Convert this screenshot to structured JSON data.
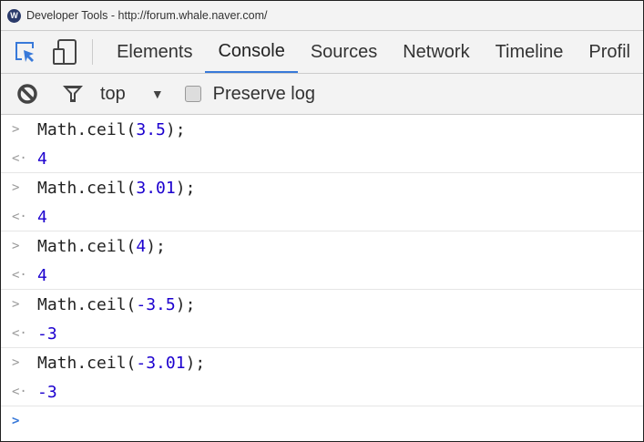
{
  "window": {
    "title": "Developer Tools - http://forum.whale.naver.com/"
  },
  "tabs": [
    {
      "label": "Elements"
    },
    {
      "label": "Console",
      "active": true
    },
    {
      "label": "Sources"
    },
    {
      "label": "Network"
    },
    {
      "label": "Timeline"
    },
    {
      "label": "Profil"
    }
  ],
  "toolbar": {
    "context": "top",
    "preserve_log_label": "Preserve log",
    "preserve_log_checked": false
  },
  "entries": [
    {
      "prefix": "Math.ceil(",
      "arg": "3.5",
      "suffix": ");",
      "result": "4"
    },
    {
      "prefix": "Math.ceil(",
      "arg": "3.01",
      "suffix": ");",
      "result": "4"
    },
    {
      "prefix": "Math.ceil(",
      "arg": "4",
      "suffix": ");",
      "result": "4"
    },
    {
      "prefix": "Math.ceil(",
      "arg": "-3.5",
      "suffix": ");",
      "result": "-3"
    },
    {
      "prefix": "Math.ceil(",
      "arg": "-3.01",
      "suffix": ");",
      "result": "-3"
    }
  ],
  "glyphs": {
    "input": ">",
    "output": "<·",
    "prompt": ">"
  },
  "colors": {
    "accent": "#3879d9",
    "number": "#1c00cf"
  }
}
